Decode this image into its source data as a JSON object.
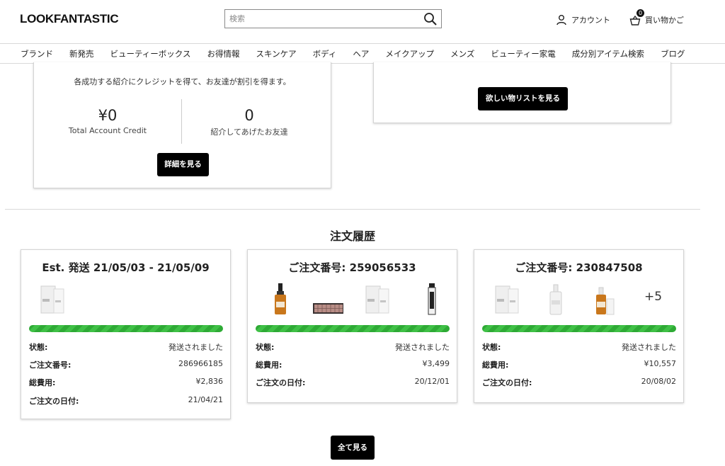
{
  "header": {
    "logo": "LOOKFANTASTIC",
    "search_placeholder": "検索",
    "account_label": "アカウント",
    "basket_label": "買い物かご",
    "basket_count": "0"
  },
  "nav": [
    "ブランド",
    "新発売",
    "ビューティーボックス",
    "お得情報",
    "スキンケア",
    "ボディ",
    "ヘア",
    "メイクアップ",
    "メンズ",
    "ビューティー家電",
    "成分別アイテム検索",
    "ブログ"
  ],
  "referral": {
    "description": "各成功する紹介にクレジットを得て、お友達が割引を得ます。",
    "credit_value": "¥0",
    "credit_label": "Total Account Credit",
    "friends_value": "0",
    "friends_label": "紹介してあげたお友達",
    "button": "詳細を見る"
  },
  "wishlist": {
    "button": "欲しい物リストを見る"
  },
  "orders_section": {
    "title": "注文履歴",
    "view_all": "全て見る",
    "orders": [
      {
        "title": "Est. 発送 21/05/03 - 21/05/09",
        "thumbs": [
          "tube-icon"
        ],
        "more": "",
        "progress": 1.0,
        "rows": [
          {
            "k": "状態:",
            "v": "発送されました"
          },
          {
            "k": "ご注文番号:",
            "v": "286966185"
          },
          {
            "k": "総費用:",
            "v": "¥2,836"
          },
          {
            "k": "ご注文の日付:",
            "v": "21/04/21"
          }
        ]
      },
      {
        "title": "ご注文番号: 259056533",
        "thumbs": [
          "dropper-bottle-icon",
          "eyeshadow-palette-icon",
          "tube-icon",
          "mascara-icon"
        ],
        "more": "",
        "progress": 1.0,
        "rows": [
          {
            "k": "状態:",
            "v": "発送されました"
          },
          {
            "k": "総費用:",
            "v": "¥3,499"
          },
          {
            "k": "ご注文の日付:",
            "v": "20/12/01"
          }
        ]
      },
      {
        "title": "ご注文番号: 230847508",
        "thumbs": [
          "tube-icon",
          "serum-bottle-icon",
          "dropper-bottle-icon"
        ],
        "more": "+5",
        "progress": 1.0,
        "rows": [
          {
            "k": "状態:",
            "v": "発送されました"
          },
          {
            "k": "総費用:",
            "v": "¥10,557"
          },
          {
            "k": "ご注文の日付:",
            "v": "20/08/02"
          }
        ]
      }
    ]
  },
  "colors": {
    "progress": "#2eaa35",
    "button": "#000000"
  }
}
